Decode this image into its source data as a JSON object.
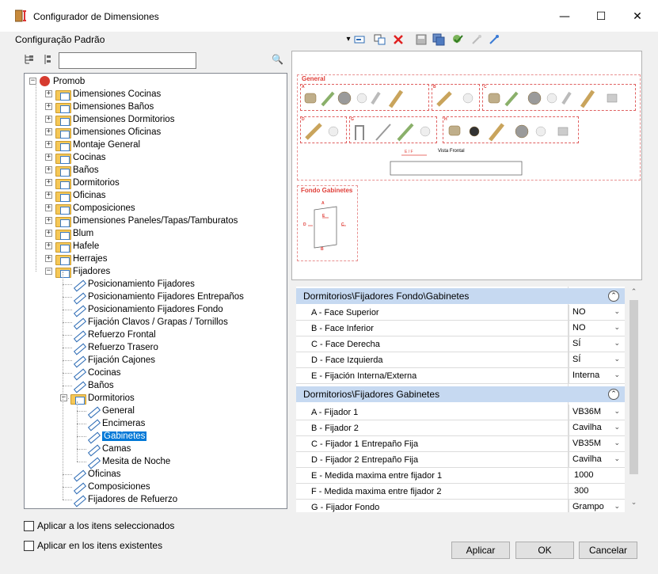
{
  "window": {
    "title": "Configurador de Dimensiones",
    "minimize_glyph": "—",
    "maximize_glyph": "☐",
    "close_glyph": "✕"
  },
  "toolbar": {
    "config_label": "Configuração Padrão",
    "dropdown_glyph": "▾",
    "icons": [
      "add-config-icon",
      "copy-config-icon",
      "delete-icon",
      "save-icon",
      "save-all-icon",
      "apply-check-icon",
      "link-icon",
      "unlink-icon"
    ]
  },
  "tree_tools": {
    "search_value": "",
    "search_glyph": "🔍"
  },
  "tree": {
    "root": "Promob",
    "top_items": [
      "Dimensiones Cocinas",
      "Dimensiones Baños",
      "Dimensiones Dormitorios",
      "Dimensiones Oficinas",
      "Montaje General",
      "Cocinas",
      "Baños",
      "Dormitorios",
      "Oficinas",
      "Composiciones",
      "Dimensiones Paneles/Tapas/Tamburatos",
      "Blum",
      "Hafele",
      "Herrajes"
    ],
    "fijadores": "Fijadores",
    "fijadores_items": [
      "Posicionamiento Fijadores",
      "Posicionamiento Fijadores Entrepaños",
      "Posicionamiento Fijadores Fondo",
      "Fijación Clavos / Grapas / Tornillos",
      "Refuerzo Frontal",
      "Refuerzo Trasero",
      "Fijación Cajones",
      "Cocinas",
      "Baños"
    ],
    "dormitorios": "Dormitorios",
    "dormitorios_items": [
      "General",
      "Encimeras",
      "Gabinetes",
      "Camas",
      "Mesita de Noche"
    ],
    "after_items": [
      "Oficinas",
      "Composiciones",
      "Fijadores de Refuerzo"
    ]
  },
  "preview": {
    "general_title": "General",
    "fondo_title": "Fondo Gabinetes",
    "vista_frontal": "Vista Frontal",
    "ef_label": "E / F",
    "letters": [
      "A",
      "B",
      "C",
      "D",
      "G",
      "H"
    ],
    "fondo_letters": [
      "A",
      "B",
      "C",
      "D",
      "E"
    ]
  },
  "props": {
    "section1": {
      "title": "Dormitorios\\Fijadores Fondo\\Gabinetes",
      "rows": [
        {
          "label": "A - Face Superior",
          "value": "NO"
        },
        {
          "label": "B - Face Inferior",
          "value": "NO"
        },
        {
          "label": "C - Face Derecha",
          "value": "SÍ"
        },
        {
          "label": "D - Face Izquierda",
          "value": "SÍ"
        },
        {
          "label": "E - Fijación Interna/Externa",
          "value": "Interna"
        }
      ]
    },
    "section2": {
      "title": "Dormitorios\\Fijadores Gabinetes",
      "rows": [
        {
          "label": "A - Fijador 1",
          "value": "VB36M"
        },
        {
          "label": "B - Fijador 2",
          "value": "Cavilha"
        },
        {
          "label": "C - Fijador 1 Entrepaño Fija",
          "value": "VB35M"
        },
        {
          "label": "D - Fijador 2 Entrepaño Fija",
          "value": "Cavilha"
        },
        {
          "label": "E - Medida maxima entre fijador 1",
          "value": "1000"
        },
        {
          "label": "F - Medida maxima entre fijador 2",
          "value": "300"
        },
        {
          "label": "G - Fijador Fondo",
          "value": "Grampo"
        }
      ]
    },
    "collapse_glyph": "⌃",
    "dropdown_glyph": "⌄"
  },
  "checks": {
    "selected_items": "Aplicar a los itens seleccionados",
    "existing_items": "Aplicar en los itens existentes"
  },
  "buttons": {
    "apply": "Aplicar",
    "ok": "OK",
    "cancel": "Cancelar"
  },
  "colors": {
    "selection": "#0078d7",
    "section_header": "#c6d9f1",
    "preview_accent": "#e0403a"
  }
}
